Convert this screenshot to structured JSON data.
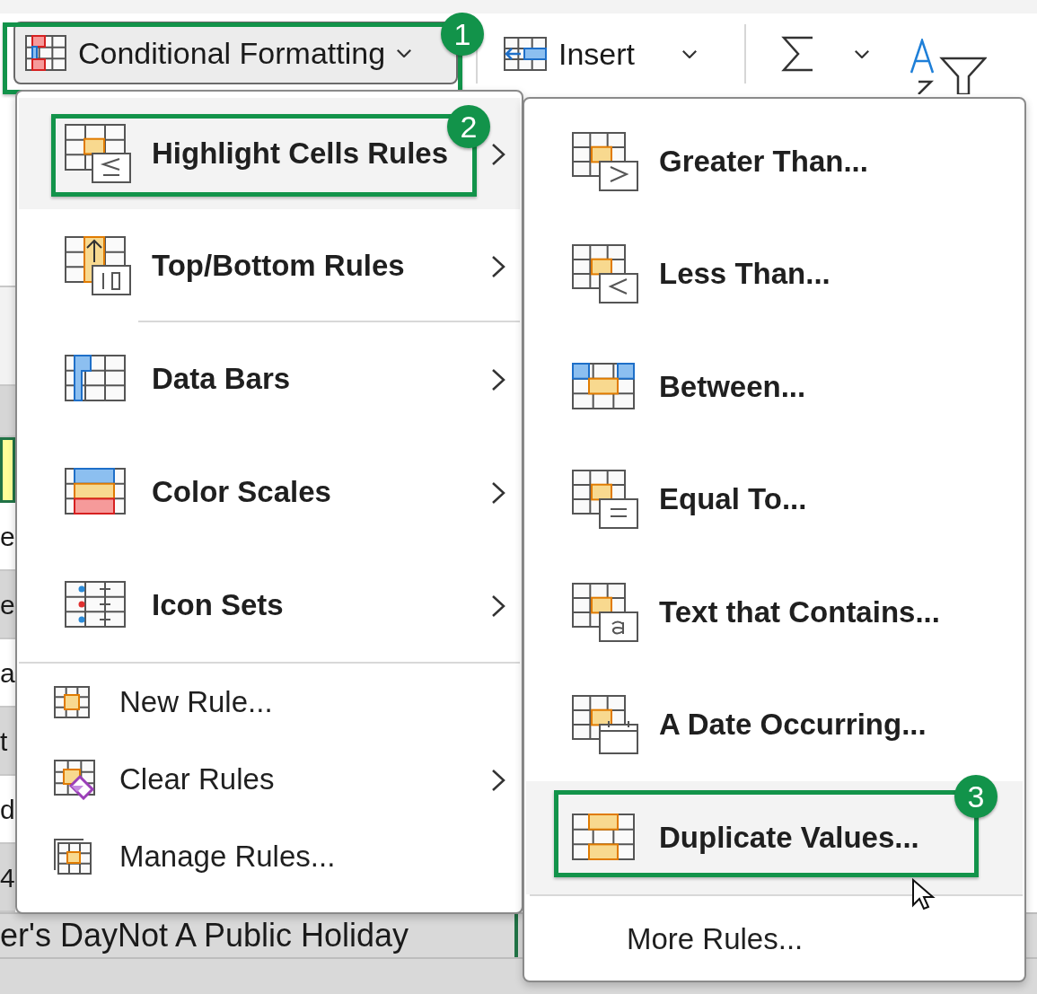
{
  "ribbon": {
    "conditional_formatting": {
      "label": "Conditional Formatting",
      "callout": "1"
    },
    "insert": {
      "label": "Insert"
    }
  },
  "sheet": {
    "left_column": [
      "e",
      "e",
      "a",
      "t",
      "d",
      "4"
    ],
    "rows": [
      "er's DayNot A Public Holiday"
    ]
  },
  "menu": {
    "items": [
      {
        "label": "Highlight Cells Rules",
        "kind": "rule",
        "selected": true,
        "submenu": true,
        "callout": "2",
        "separator_after": false
      },
      {
        "label": "Top/Bottom Rules",
        "kind": "rule",
        "selected": false,
        "submenu": true,
        "separator_after": true
      },
      {
        "label": "Data Bars",
        "kind": "rule",
        "selected": false,
        "submenu": true,
        "separator_after": false
      },
      {
        "label": "Color Scales",
        "kind": "rule",
        "selected": false,
        "submenu": true,
        "separator_after": false
      },
      {
        "label": "Icon Sets",
        "kind": "rule",
        "selected": false,
        "submenu": true,
        "separator_after": false
      },
      {
        "label": "New Rule...",
        "kind": "action",
        "selected": false,
        "submenu": false,
        "separator_after": false
      },
      {
        "label": "Clear Rules",
        "kind": "action",
        "selected": false,
        "submenu": true,
        "separator_after": false
      },
      {
        "label": "Manage Rules...",
        "kind": "action",
        "selected": false,
        "submenu": false,
        "separator_after": false
      }
    ]
  },
  "submenu": {
    "items": [
      {
        "label": "Greater Than...",
        "kind": "rule",
        "selected": false
      },
      {
        "label": "Less Than...",
        "kind": "rule",
        "selected": false
      },
      {
        "label": "Between...",
        "kind": "rule",
        "selected": false
      },
      {
        "label": "Equal To...",
        "kind": "rule",
        "selected": false
      },
      {
        "label": "Text that Contains...",
        "kind": "rule",
        "selected": false
      },
      {
        "label": "A Date Occurring...",
        "kind": "rule",
        "selected": false
      },
      {
        "label": "Duplicate Values...",
        "kind": "rule",
        "selected": true,
        "callout": "3"
      },
      {
        "label": "More Rules...",
        "kind": "more",
        "selected": false
      }
    ]
  }
}
